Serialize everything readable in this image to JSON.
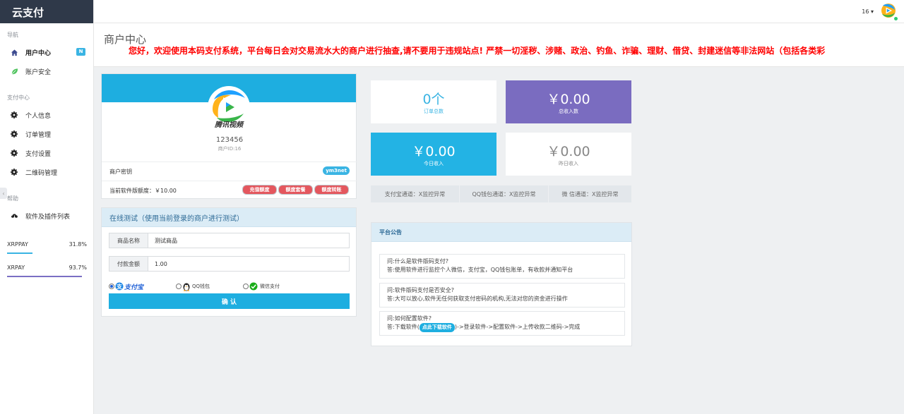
{
  "brand": "云支付",
  "sidebar": {
    "sections": [
      "导航",
      "支付中心",
      "帮助"
    ],
    "items": [
      {
        "label": "用户中心",
        "badge": "N"
      },
      {
        "label": "账户安全"
      },
      {
        "label": "个人信息"
      },
      {
        "label": "订单管理"
      },
      {
        "label": "支付设置"
      },
      {
        "label": "二维码管理"
      },
      {
        "label": "软件及插件列表"
      }
    ],
    "collapse": "‹",
    "stats": [
      {
        "label": "XRPPAY",
        "value": "31.8%",
        "percent": 31.8,
        "color": "#3ab4e3"
      },
      {
        "label": "XRPAY",
        "value": "93.7%",
        "percent": 93.7,
        "color": "#7b6fc4"
      }
    ]
  },
  "topbar": {
    "user": "16 ▾"
  },
  "page": {
    "title": "商户中心",
    "notice": "您好，欢迎使用本码支付系统，平台每日会对交易流水大的商户进行抽查,请不要用于违规站点! 严禁一切淫秽、涉赌、政治、钓鱼、诈骗、理财、借贷、封建迷信等非法网站（包括各类彩"
  },
  "profile": {
    "avatar_text": "腾讯视频",
    "username": "123456",
    "merchant_id": "商户ID:16",
    "key_label": "商户密钥",
    "key_badge": "ym3net",
    "quota_label": "当前软件版额度：￥10.00",
    "buttons": [
      "充值额度",
      "额度套餐",
      "额度转账"
    ]
  },
  "test": {
    "header": "在线测试（使用当前登录的商户进行测试）",
    "product_label": "商品名称",
    "product_value": "测试商品",
    "amount_label": "付款金额",
    "amount_value": "1.00",
    "options": [
      "支付宝",
      "QQ钱包",
      "微信支付"
    ],
    "selected": "支付宝",
    "confirm": "确 认"
  },
  "tiles": [
    {
      "value": "0个",
      "label": "订单总数",
      "bg": "#ffffff",
      "fg": "#3ab4e3"
    },
    {
      "value": "￥0.00",
      "label": "总收入数",
      "bg": "#7a6cc0",
      "fg": "#ffffff"
    },
    {
      "value": "￥0.00",
      "label": "今日收入",
      "bg": "#23b3e4",
      "fg": "#ffffff"
    },
    {
      "value": "￥0.00",
      "label": "昨日收入",
      "bg": "#ffffff",
      "fg": "#888888"
    }
  ],
  "channels": [
    "支付宝通道：X监控异常",
    "QQ钱包通道：X监控异常",
    "微 信通道：X监控异常"
  ],
  "announce": {
    "header": "平台公告",
    "items": [
      {
        "q": "问:什么是软件版码支付?",
        "a": "答:使用软件进行监控个人微信，支付宝，QQ钱包账单，有收款并通知平台"
      },
      {
        "q": "问:软件版码支付是否安全?",
        "a": "答:大可以放心,软件无任何获取支付密码的机构,无法对您的资金进行操作"
      },
      {
        "q": "问:如何配置软件?",
        "a_pre": "答:下载软件(",
        "a_badge": "点此下载软件",
        "a_post": ")->登录软件->配置软件->上传收款二维码->完成"
      }
    ]
  },
  "colors": {
    "accent": "#1eaee0",
    "brand_bg": "#2f3949",
    "notice": "#ff0000",
    "danger": "#e4575e"
  }
}
